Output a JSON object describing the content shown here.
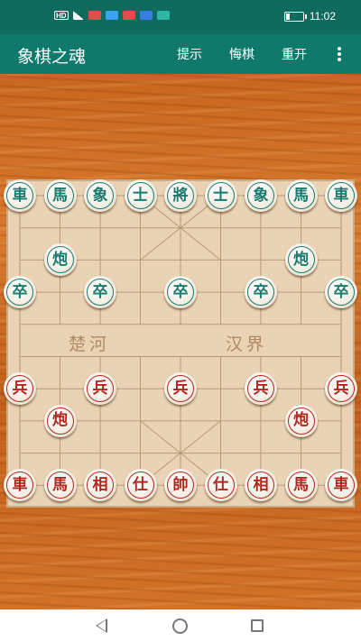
{
  "status_bar": {
    "network_label": "HD",
    "time": "11:02",
    "battery_level": 0.25
  },
  "app_bar": {
    "title": "象棋之魂",
    "menu": {
      "hint": "提示",
      "undo": "悔棋",
      "restart": "重开"
    },
    "overflow_icon": "more-vert-icon"
  },
  "board": {
    "columns": 9,
    "rows": 10,
    "river_left": "楚河",
    "river_right": "汉界",
    "pieces": [
      {
        "side": "green",
        "label": "車",
        "col": 0,
        "row": 0
      },
      {
        "side": "green",
        "label": "馬",
        "col": 1,
        "row": 0
      },
      {
        "side": "green",
        "label": "象",
        "col": 2,
        "row": 0
      },
      {
        "side": "green",
        "label": "士",
        "col": 3,
        "row": 0
      },
      {
        "side": "green",
        "label": "將",
        "col": 4,
        "row": 0
      },
      {
        "side": "green",
        "label": "士",
        "col": 5,
        "row": 0
      },
      {
        "side": "green",
        "label": "象",
        "col": 6,
        "row": 0
      },
      {
        "side": "green",
        "label": "馬",
        "col": 7,
        "row": 0
      },
      {
        "side": "green",
        "label": "車",
        "col": 8,
        "row": 0
      },
      {
        "side": "green",
        "label": "炮",
        "col": 1,
        "row": 2
      },
      {
        "side": "green",
        "label": "炮",
        "col": 7,
        "row": 2
      },
      {
        "side": "green",
        "label": "卒",
        "col": 0,
        "row": 3
      },
      {
        "side": "green",
        "label": "卒",
        "col": 2,
        "row": 3
      },
      {
        "side": "green",
        "label": "卒",
        "col": 4,
        "row": 3
      },
      {
        "side": "green",
        "label": "卒",
        "col": 6,
        "row": 3
      },
      {
        "side": "green",
        "label": "卒",
        "col": 8,
        "row": 3
      },
      {
        "side": "red",
        "label": "兵",
        "col": 0,
        "row": 6
      },
      {
        "side": "red",
        "label": "兵",
        "col": 2,
        "row": 6
      },
      {
        "side": "red",
        "label": "兵",
        "col": 4,
        "row": 6
      },
      {
        "side": "red",
        "label": "兵",
        "col": 6,
        "row": 6
      },
      {
        "side": "red",
        "label": "兵",
        "col": 8,
        "row": 6
      },
      {
        "side": "red",
        "label": "炮",
        "col": 1,
        "row": 7
      },
      {
        "side": "red",
        "label": "炮",
        "col": 7,
        "row": 7
      },
      {
        "side": "red",
        "label": "車",
        "col": 0,
        "row": 9
      },
      {
        "side": "red",
        "label": "馬",
        "col": 1,
        "row": 9
      },
      {
        "side": "red",
        "label": "相",
        "col": 2,
        "row": 9
      },
      {
        "side": "red",
        "label": "仕",
        "col": 3,
        "row": 9
      },
      {
        "side": "red",
        "label": "帥",
        "col": 4,
        "row": 9
      },
      {
        "side": "red",
        "label": "仕",
        "col": 5,
        "row": 9
      },
      {
        "side": "red",
        "label": "相",
        "col": 6,
        "row": 9
      },
      {
        "side": "red",
        "label": "馬",
        "col": 7,
        "row": 9
      },
      {
        "side": "red",
        "label": "車",
        "col": 8,
        "row": 9
      }
    ]
  },
  "nav_bar": {
    "back_icon": "back-triangle-icon",
    "home_icon": "home-circle-icon",
    "recent_icon": "recent-square-icon"
  },
  "colors": {
    "primary": "#0f7a6b",
    "status_bar": "#0f6b5e",
    "board_paper": "#e9d3b4",
    "grid_line": "#b89a78",
    "green_piece": "#1b7a6e",
    "red_piece": "#b3261e"
  }
}
